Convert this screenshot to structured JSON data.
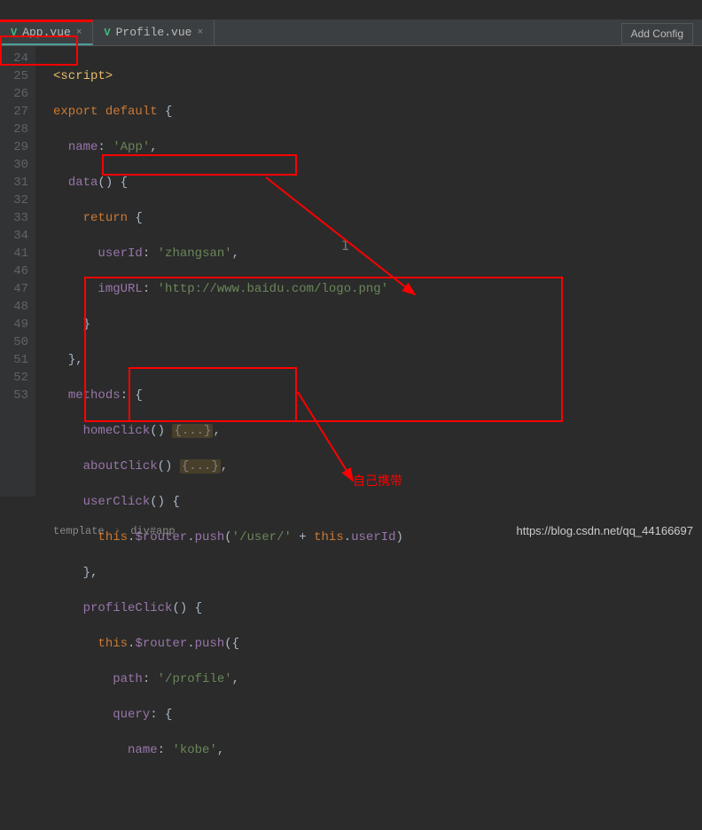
{
  "toolbar": {
    "add_config": "Add Config"
  },
  "tabs": [
    {
      "label": "App.vue",
      "active": true
    },
    {
      "label": "Profile.vue",
      "active": false
    }
  ],
  "line_numbers": [
    "24",
    "25",
    "26",
    "27",
    "28",
    "29",
    "30",
    "31",
    "32",
    "33",
    "34",
    "41",
    "46",
    "47",
    "48",
    "49",
    "50",
    "51",
    "52",
    "53"
  ],
  "code": {
    "l24": {
      "tag": "<script>"
    },
    "l25": {
      "kw1": "export ",
      "kw2": "default ",
      "p": "{"
    },
    "l26": {
      "prop": "name",
      "p1": ": ",
      "str": "'App'",
      "p2": ","
    },
    "l27": {
      "fn": "data",
      "p": "() {"
    },
    "l28": {
      "kw": "return ",
      "p": "{"
    },
    "l29": {
      "prop": "userId",
      "p1": ": ",
      "str": "'zhangsan'",
      "p2": ","
    },
    "l30": {
      "prop": "imgURL",
      "p1": ": ",
      "str": "'http://www.baidu.com/logo.png'"
    },
    "l31": {
      "p": "}"
    },
    "l32": {
      "p": "},"
    },
    "l33": {
      "prop": "methods",
      "p": ": {"
    },
    "l34": {
      "fn": "homeClick",
      "p1": "() ",
      "fold": "{...}",
      "p2": ","
    },
    "l41": {
      "fn": "aboutClick",
      "p1": "() ",
      "fold": "{...}",
      "p2": ","
    },
    "l46": {
      "fn": "userClick",
      "p1": "() {"
    },
    "l47": {
      "this": "this",
      "p1": ".",
      "router": "$router",
      "p2": ".",
      "push": "push",
      "p3": "(",
      "str": "'/user/'",
      "p4": " + ",
      "this2": "this",
      "p5": ".",
      "uid": "userId",
      "p6": ")"
    },
    "l48": {
      "p": "},"
    },
    "l49": {
      "fn": "profileClick",
      "p1": "() {"
    },
    "l50": {
      "this": "this",
      "p1": ".",
      "router": "$router",
      "p2": ".",
      "push": "push",
      "p3": "({"
    },
    "l51": {
      "prop": "path",
      "p1": ": ",
      "str": "'/profile'",
      "p2": ","
    },
    "l52": {
      "prop": "query",
      "p": ": {"
    },
    "l53": {
      "prop": "name",
      "p1": ": ",
      "str": "'kobe'",
      "p2": ","
    }
  },
  "breadcrumb": {
    "a": "template",
    "b": "div#app"
  },
  "watermark": "https://blog.csdn.net/qq_44166697",
  "annotations": {
    "label1": "自己携带"
  }
}
